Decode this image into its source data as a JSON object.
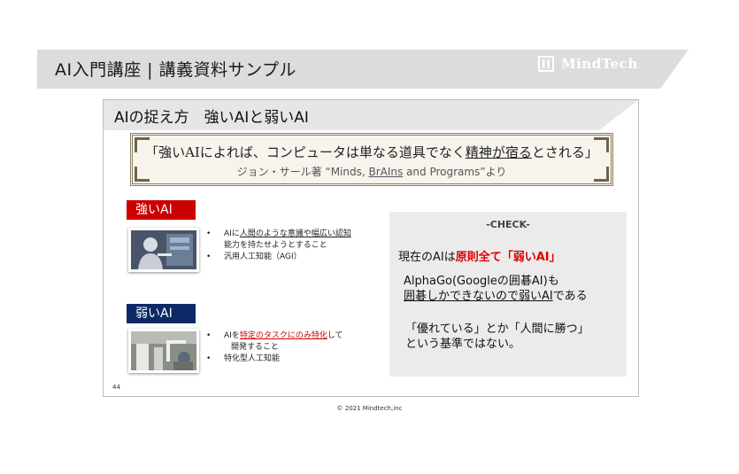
{
  "header": {
    "title": "AI入門講座 | 講義資料サンプル",
    "brand": "MindTech"
  },
  "slide": {
    "title": "AIの捉え方　強いAIと弱いAI",
    "quote": {
      "part1": "「強いAIによれば、コンピュータは単なる道具でなく",
      "part2": "精神が宿る",
      "part3": "とされる」",
      "sub_part1": "ジョン・サール著 “Minds, ",
      "sub_part2": "BrAIns",
      "sub_part3": " and Programs”より"
    },
    "strong": {
      "label": "強いAI",
      "bullet1_a": "AIに",
      "bullet1_b": "人間のような意識や幅広い認知",
      "bullet1_c": "能力を持たせようとすること",
      "bullet2": "汎用人工知能（AGI）"
    },
    "weak": {
      "label": "弱いAI",
      "bullet1_a": "AIを",
      "bullet1_b": "特定のタスクにのみ特化",
      "bullet1_c": "して",
      "bullet1_d": "開発すること",
      "bullet2": "特化型人工知能"
    },
    "check": {
      "title": "-CHECK-",
      "line1_a": "現在のAIは",
      "line1_b": "原則全て「弱いAI」",
      "line2_a": "AlphaGo(Googleの囲碁AI)も",
      "line2_b": "囲碁しかできないので弱いAI",
      "line2_c": "である",
      "line3_a": "「優れている」とか「人間に勝つ」",
      "line3_b": "という基準ではない。"
    },
    "page_number": "44"
  },
  "footer": {
    "copyright": "© 2021 Mindtech,inc"
  },
  "colors": {
    "header_band": "#dcdcdc",
    "strong_badge": "#cc0000",
    "weak_badge": "#0c2a66",
    "emphasis": "#e00000",
    "check_bg": "#ebebeb"
  }
}
